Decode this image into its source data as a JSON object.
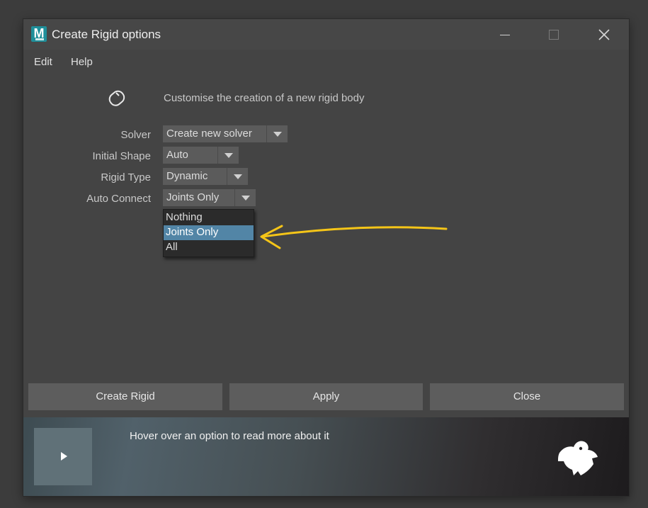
{
  "window": {
    "title": "Create Rigid options",
    "app_icon": "maya-m-logo",
    "controls": [
      "minimize-icon",
      "maximize-icon",
      "close-icon"
    ]
  },
  "menu": {
    "items": [
      "Edit",
      "Help"
    ]
  },
  "header": {
    "icon": "rigid-body-icon",
    "text": "Customise the creation of a new rigid body"
  },
  "form": {
    "solver": {
      "label": "Solver",
      "value": "Create new solver"
    },
    "initial_shape": {
      "label": "Initial Shape",
      "value": "Auto"
    },
    "rigid_type": {
      "label": "Rigid Type",
      "value": "Dynamic"
    },
    "auto_connect": {
      "label": "Auto Connect",
      "value": "Joints Only"
    }
  },
  "dropdown": {
    "options": [
      "Nothing",
      "Joints Only",
      "All"
    ],
    "selected_index": 1
  },
  "annotation": {
    "color": "#f5c518"
  },
  "buttons": {
    "create": "Create Rigid",
    "apply": "Apply",
    "close": "Close"
  },
  "help": {
    "text": "Hover over an option to read more about it",
    "play_icon": "play-icon",
    "mascot_icon": "mascot-icon"
  },
  "colors": {
    "background": "#444444",
    "selection": "#5285a6",
    "button": "#5d5d5d"
  }
}
